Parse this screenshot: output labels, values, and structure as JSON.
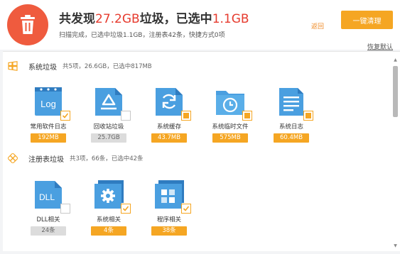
{
  "header": {
    "headline_prefix": "共发现",
    "found_size": "27.2GB",
    "headline_mid": "垃圾，已选中",
    "selected_size": "1.1GB",
    "subline": "扫描完成，已选中垃圾1.1GB，注册表42条，快捷方式0项",
    "back_label": "返回",
    "clean_button": "一键清理",
    "restore_label": "恢复默认"
  },
  "sections": [
    {
      "title": "系统垃圾",
      "stats": "共5项，26.6GB，已选中817MB",
      "items": [
        {
          "label": "常用软件日志",
          "value": "192MB",
          "icon": "log-file-icon",
          "check": "checked",
          "selected": true
        },
        {
          "label": "回收站垃圾",
          "value": "25.7GB",
          "icon": "recycle-bin-icon",
          "check": "unchecked",
          "selected": false
        },
        {
          "label": "系统缓存",
          "value": "43.7MB",
          "icon": "cache-refresh-icon",
          "check": "partial",
          "selected": true
        },
        {
          "label": "系统临时文件",
          "value": "575MB",
          "icon": "temp-folder-clock-icon",
          "check": "partial",
          "selected": true
        },
        {
          "label": "系统日志",
          "value": "60.4MB",
          "icon": "system-log-icon",
          "check": "partial",
          "selected": true
        }
      ]
    },
    {
      "title": "注册表垃圾",
      "stats": "共3项，66条，已选中42条",
      "items": [
        {
          "label": "DLL相关",
          "value": "24条",
          "icon": "dll-file-icon",
          "check": "unchecked",
          "selected": false
        },
        {
          "label": "系统相关",
          "value": "4条",
          "icon": "system-gear-icon",
          "check": "checked",
          "selected": true
        },
        {
          "label": "程序相关",
          "value": "38条",
          "icon": "program-apps-icon",
          "check": "checked",
          "selected": true
        }
      ]
    }
  ],
  "colors": {
    "accent": "#f5a623",
    "highlight_red": "#e63b2e",
    "tile_blue": "#4a9fe0",
    "trash_circle": "#ef5b3e"
  }
}
